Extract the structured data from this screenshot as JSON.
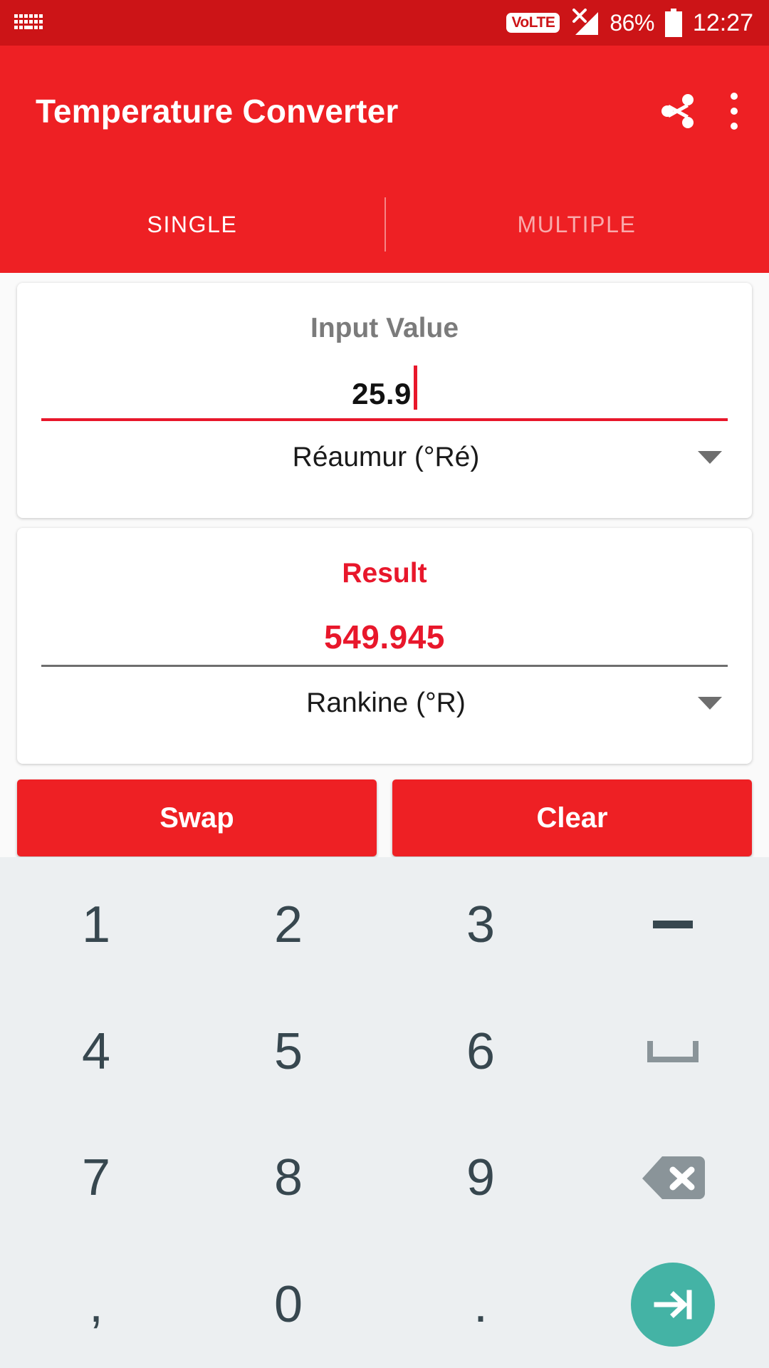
{
  "statusbar": {
    "keyboard_icon": "keyboard-icon",
    "volte_label": "VoLTE",
    "signal_icon": "signal-no-service-icon",
    "battery_percent": "86%",
    "battery_icon": "battery-icon",
    "clock": "12:27"
  },
  "appbar": {
    "title": "Temperature Converter",
    "share_icon": "share-icon",
    "overflow_icon": "overflow-menu-icon",
    "background": "#EE2024"
  },
  "tabs": [
    {
      "label": "SINGLE",
      "selected": true
    },
    {
      "label": "MULTIPLE",
      "selected": false
    }
  ],
  "input_card": {
    "label": "Input Value",
    "value": "25.9",
    "unit": "Réaumur (°Ré)",
    "dropdown_icon": "chevron-down-icon",
    "underline_color": "#E8172B"
  },
  "result_card": {
    "label": "Result",
    "value": "549.945",
    "unit": "Rankine (°R)",
    "dropdown_icon": "chevron-down-icon",
    "label_color": "#E8172B",
    "underline_color": "#6E6E6E"
  },
  "actions": {
    "swap_label": "Swap",
    "clear_label": "Clear"
  },
  "keyboard": {
    "background": "#ECEFF1",
    "key_color": "#37474F",
    "enter_color": "#44B3A5",
    "backspace_color": "#8A9499",
    "rows": [
      [
        {
          "label": "1",
          "name": "key-1",
          "type": "digit"
        },
        {
          "label": "2",
          "name": "key-2",
          "type": "digit"
        },
        {
          "label": "3",
          "name": "key-3",
          "type": "digit"
        },
        {
          "label": "−",
          "name": "key-minus",
          "type": "minus"
        }
      ],
      [
        {
          "label": "4",
          "name": "key-4",
          "type": "digit"
        },
        {
          "label": "5",
          "name": "key-5",
          "type": "digit"
        },
        {
          "label": "6",
          "name": "key-6",
          "type": "digit"
        },
        {
          "label": "⌴",
          "name": "key-space",
          "type": "space"
        }
      ],
      [
        {
          "label": "7",
          "name": "key-7",
          "type": "digit"
        },
        {
          "label": "8",
          "name": "key-8",
          "type": "digit"
        },
        {
          "label": "9",
          "name": "key-9",
          "type": "digit"
        },
        {
          "label": "⌫",
          "name": "key-backspace",
          "type": "backspace"
        }
      ],
      [
        {
          "label": ",",
          "name": "key-comma",
          "type": "digit"
        },
        {
          "label": "0",
          "name": "key-0",
          "type": "digit"
        },
        {
          "label": ".",
          "name": "key-period",
          "type": "digit"
        },
        {
          "label": "⇥",
          "name": "key-enter",
          "type": "enter"
        }
      ]
    ]
  }
}
